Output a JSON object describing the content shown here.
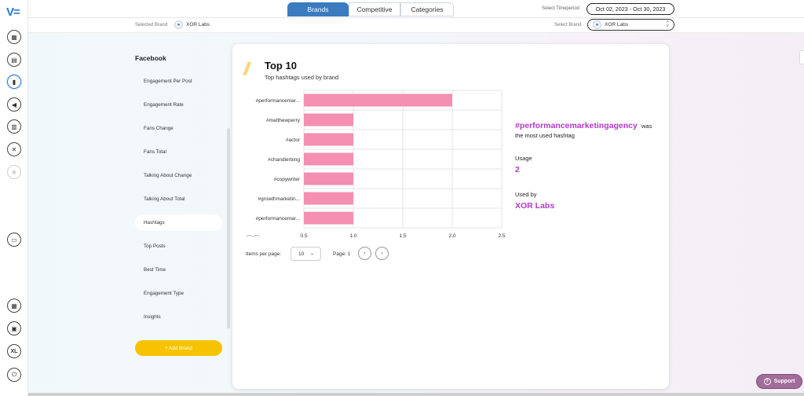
{
  "app": {
    "logo_text": "V",
    "logo_accent": "="
  },
  "rail": {
    "icons": [
      {
        "name": "calendar-icon",
        "glyph": "▦"
      },
      {
        "name": "calendar-check-icon",
        "glyph": "▤"
      },
      {
        "name": "bar-chart-icon",
        "glyph": "▮"
      },
      {
        "name": "megaphone-icon",
        "glyph": "◀"
      },
      {
        "name": "clipboard-icon",
        "glyph": "▥"
      },
      {
        "name": "link-icon",
        "glyph": "✕"
      },
      {
        "name": "spinner-icon",
        "glyph": "✺"
      },
      {
        "name": "monitor-icon",
        "glyph": "▭"
      },
      {
        "name": "bank-icon",
        "glyph": "▦"
      },
      {
        "name": "settings-box-icon",
        "glyph": "▣"
      },
      {
        "name": "user-initials",
        "glyph": "XL"
      },
      {
        "name": "power-icon",
        "glyph": "⏻"
      }
    ]
  },
  "header": {
    "tabs": [
      {
        "label": "Brands",
        "active": true
      },
      {
        "label": "Competitive",
        "active": false
      },
      {
        "label": "Categories",
        "active": false
      }
    ],
    "timeperiod_label": "Select Timeperiod",
    "timeperiod_value": "Oct 02, 2023 - Oct 30, 2023"
  },
  "subbar": {
    "selected_brand_label": "Selected Brand",
    "selected_brand_value": "XOR Labs",
    "select_brand_label": "Select Brand",
    "select_brand_value": "XOR Labs"
  },
  "menu": {
    "section": "Facebook",
    "items": [
      {
        "label": "Engagement Per Post"
      },
      {
        "label": "Engagement Rate"
      },
      {
        "label": "Fans Change"
      },
      {
        "label": "Fans Total"
      },
      {
        "label": "Talking About Change"
      },
      {
        "label": "Talking About Total"
      },
      {
        "label": "Hashtags",
        "active": true
      },
      {
        "label": "Top Posts"
      },
      {
        "label": "Best Time"
      },
      {
        "label": "Engagement Type"
      },
      {
        "label": "Insights"
      }
    ],
    "add_brand": "+ Add Brand"
  },
  "card": {
    "title": "Top 10",
    "subtitle": "Top hashtags used by brand",
    "pagination": {
      "items_per_page_label": "Items per page:",
      "items_per_page_value": "10",
      "page_label": "Page: 1"
    },
    "insight": {
      "hashtag": "#performancemarketingagency",
      "was_text": "was",
      "line2": "the most used hashtag",
      "usage_label": "Usage",
      "usage_value": "2",
      "used_by_label": "Used by",
      "used_by_value": "XOR Labs"
    }
  },
  "chart_data": {
    "type": "bar",
    "orientation": "horizontal",
    "categories": [
      "#performancemar...",
      "#matthewperry",
      "#actor",
      "#chandlerbing",
      "#copywriter",
      "#growthmarketin...",
      "#performancemar..."
    ],
    "values": [
      2,
      1,
      1,
      1,
      1,
      1,
      1
    ],
    "xlim": [
      0.5,
      2.5
    ],
    "xticks": [
      "0.5",
      "1.0",
      "1.5",
      "2.0",
      "2.5"
    ],
    "grid": true,
    "bar_color": "#f48fb1"
  },
  "colors": {
    "accent": "#3b7bbf",
    "highlight": "#b23bc7",
    "add_brand": "#f7c300",
    "support": "#a16b9a"
  },
  "support": {
    "label": "Support"
  }
}
